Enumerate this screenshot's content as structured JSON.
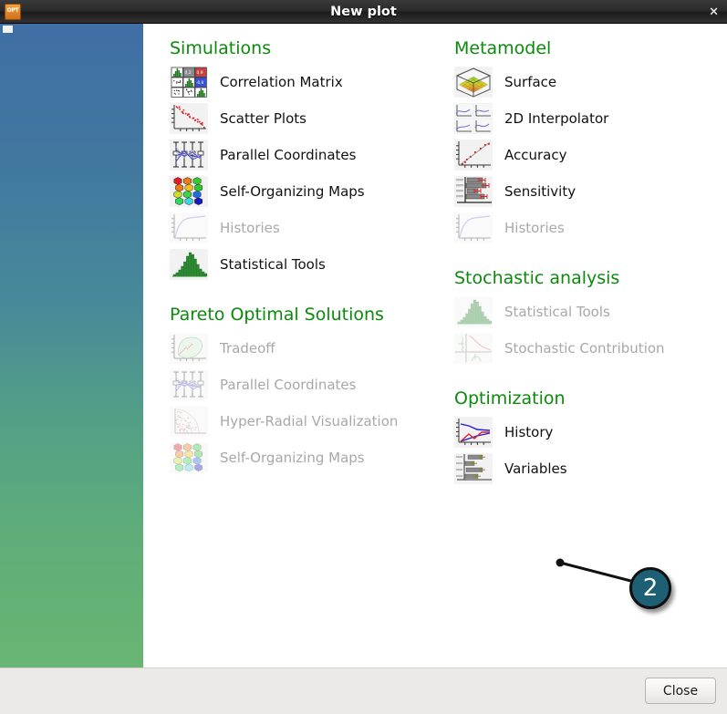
{
  "window": {
    "title": "New plot",
    "app_icon": "opt-app-icon",
    "close_icon": "×"
  },
  "sections": {
    "left": [
      {
        "title": "Simulations",
        "items": [
          {
            "label": "Correlation Matrix",
            "icon": "correlation-matrix-icon",
            "enabled": true
          },
          {
            "label": "Scatter Plots",
            "icon": "scatter-plots-icon",
            "enabled": true
          },
          {
            "label": "Parallel Coordinates",
            "icon": "parallel-coordinates-icon",
            "enabled": true
          },
          {
            "label": "Self-Organizing Maps",
            "icon": "self-organizing-maps-icon",
            "enabled": true
          },
          {
            "label": "Histories",
            "icon": "histories-icon",
            "enabled": false
          },
          {
            "label": "Statistical Tools",
            "icon": "statistical-tools-icon",
            "enabled": true
          }
        ]
      },
      {
        "title": "Pareto Optimal Solutions",
        "items": [
          {
            "label": "Tradeoff",
            "icon": "tradeoff-icon",
            "enabled": false
          },
          {
            "label": "Parallel Coordinates",
            "icon": "parallel-coordinates-icon",
            "enabled": false
          },
          {
            "label": "Hyper-Radial Visualization",
            "icon": "hyper-radial-icon",
            "enabled": false
          },
          {
            "label": "Self-Organizing Maps",
            "icon": "self-organizing-maps-icon",
            "enabled": false
          }
        ]
      }
    ],
    "right": [
      {
        "title": "Metamodel",
        "items": [
          {
            "label": "Surface",
            "icon": "surface-icon",
            "enabled": true
          },
          {
            "label": "2D Interpolator",
            "icon": "interpolator-2d-icon",
            "enabled": true
          },
          {
            "label": "Accuracy",
            "icon": "accuracy-icon",
            "enabled": true
          },
          {
            "label": "Sensitivity",
            "icon": "sensitivity-icon",
            "enabled": true
          },
          {
            "label": "Histories",
            "icon": "histories-icon",
            "enabled": false
          }
        ]
      },
      {
        "title": "Stochastic analysis",
        "items": [
          {
            "label": "Statistical Tools",
            "icon": "statistical-tools-icon",
            "enabled": false
          },
          {
            "label": "Stochastic Contribution",
            "icon": "stochastic-contribution-icon",
            "enabled": false
          }
        ]
      },
      {
        "title": "Optimization",
        "items": [
          {
            "label": "History",
            "icon": "optimization-history-icon",
            "enabled": true
          },
          {
            "label": "Variables",
            "icon": "optimization-variables-icon",
            "enabled": true
          }
        ]
      }
    ]
  },
  "footer": {
    "close_label": "Close"
  },
  "annotation": {
    "badge_number": "2",
    "target": "History"
  },
  "colors": {
    "section_header": "#0b8a0b",
    "badge": "#1d6075",
    "sidebar_top": "#3f6fa5",
    "sidebar_bottom": "#69b573",
    "disabled_text": "#a8a8a8"
  }
}
